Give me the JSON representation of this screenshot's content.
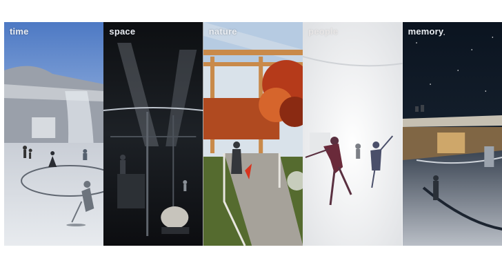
{
  "panels": [
    {
      "key": "time",
      "label": "time"
    },
    {
      "key": "space",
      "label": "space"
    },
    {
      "key": "nature",
      "label": "nature"
    },
    {
      "key": "people",
      "label": "people"
    },
    {
      "key": "memory",
      "label": "memory"
    }
  ]
}
